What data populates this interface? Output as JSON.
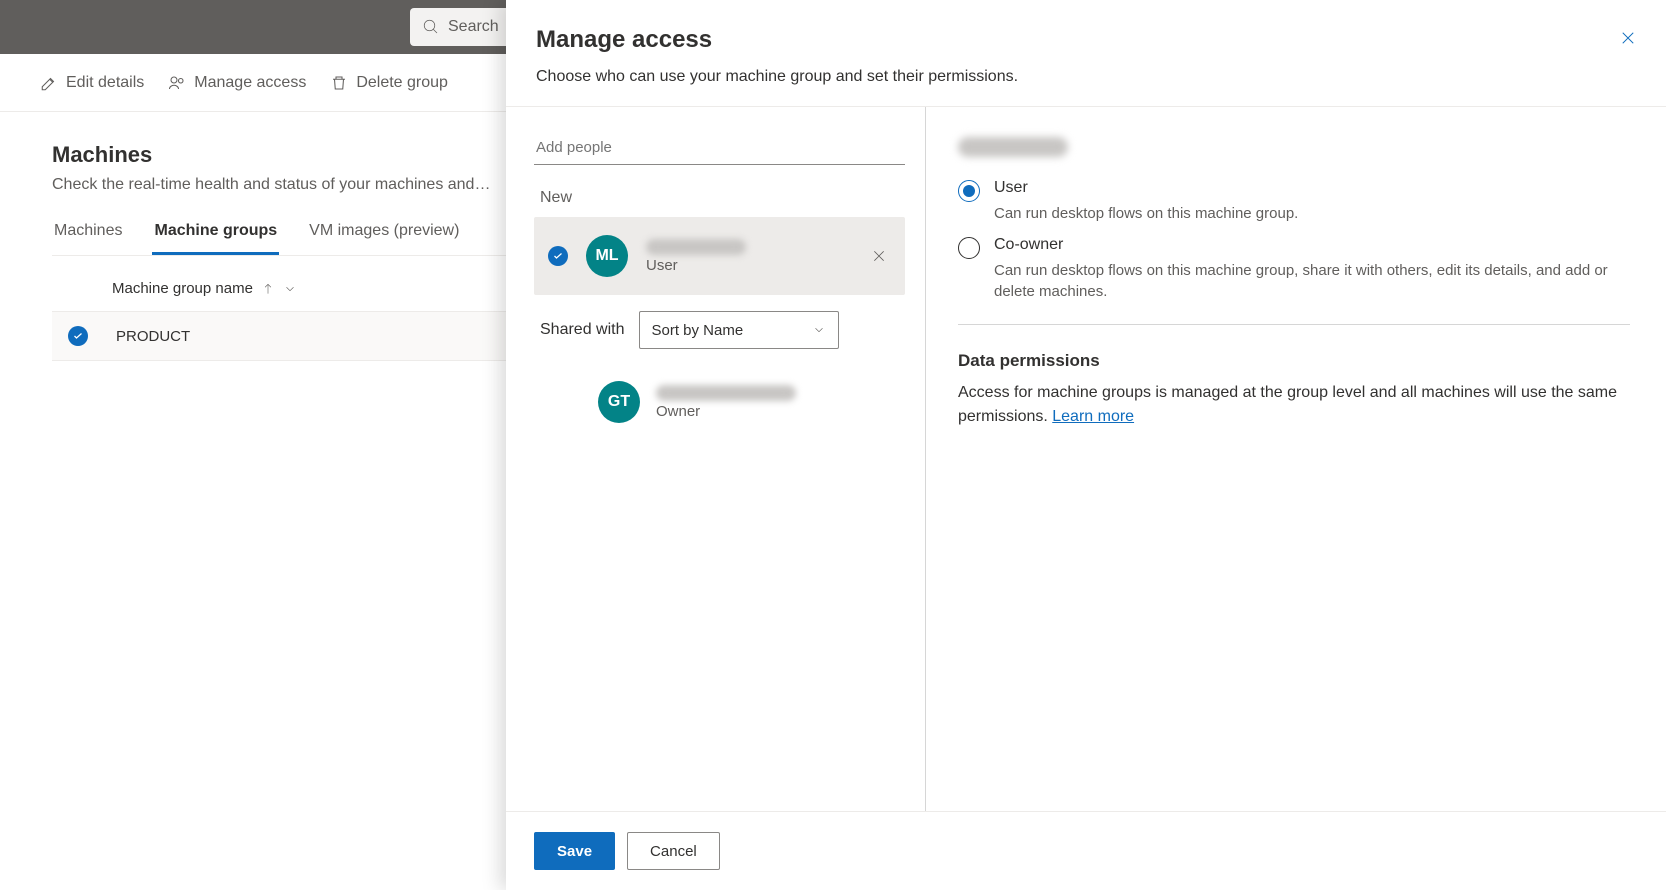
{
  "topbar": {
    "search_placeholder": "Search"
  },
  "commandbar": {
    "edit": "Edit details",
    "manage": "Manage access",
    "delete": "Delete group"
  },
  "page": {
    "title": "Machines",
    "subtitle": "Check the real-time health and status of your machines and…",
    "tabs": [
      "Machines",
      "Machine groups",
      "VM images (preview)"
    ],
    "active_tab": 1,
    "column_header": "Machine group name",
    "rows": [
      {
        "name": "PRODUCT",
        "selected": true
      }
    ]
  },
  "panel": {
    "title": "Manage access",
    "description": "Choose who can use your machine group and set their permissions.",
    "add_placeholder": "Add people",
    "new_label": "New",
    "new_people": [
      {
        "initials": "ML",
        "role": "User",
        "selected": true
      }
    ],
    "shared_label": "Shared with",
    "sort_value": "Sort by Name",
    "shared_people": [
      {
        "initials": "GT",
        "role": "Owner"
      }
    ],
    "permissions": {
      "options": [
        {
          "label": "User",
          "desc": "Can run desktop flows on this machine group.",
          "checked": true
        },
        {
          "label": "Co-owner",
          "desc": "Can run desktop flows on this machine group, share it with others, edit its details, and add or delete machines.",
          "checked": false
        }
      ]
    },
    "data_permissions": {
      "title": "Data permissions",
      "text": "Access for machine groups is managed at the group level and all machines will use the same permissions. ",
      "link": "Learn more"
    },
    "buttons": {
      "save": "Save",
      "cancel": "Cancel"
    }
  }
}
